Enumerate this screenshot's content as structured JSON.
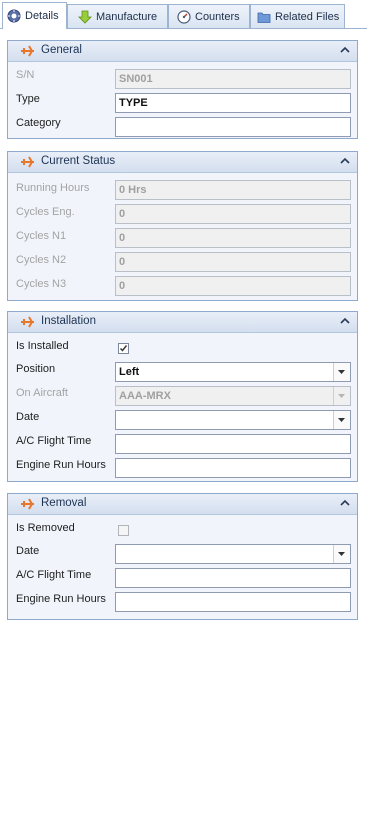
{
  "tabs": [
    {
      "label": "Details",
      "icon": "gear-list-icon",
      "active": true
    },
    {
      "label": "Manufacture",
      "icon": "down-arrow-icon",
      "active": false
    },
    {
      "label": "Counters",
      "icon": "gauge-icon",
      "active": false
    },
    {
      "label": "Related Files",
      "icon": "folder-icon",
      "active": false
    }
  ],
  "general": {
    "title": "General",
    "sn_label": "S/N",
    "sn_value": "SN001",
    "type_label": "Type",
    "type_value": "TYPE",
    "category_label": "Category",
    "category_value": ""
  },
  "current_status": {
    "title": "Current Status",
    "running_hours_label": "Running Hours",
    "running_hours_value": "0 Hrs",
    "cycles_eng_label": "Cycles Eng.",
    "cycles_eng_value": "0",
    "cycles_n1_label": "Cycles N1",
    "cycles_n1_value": "0",
    "cycles_n2_label": "Cycles N2",
    "cycles_n2_value": "0",
    "cycles_n3_label": "Cycles N3",
    "cycles_n3_value": "0"
  },
  "installation": {
    "title": "Installation",
    "is_installed_label": "Is Installed",
    "is_installed_checked": true,
    "position_label": "Position",
    "position_value": "Left",
    "on_aircraft_label": "On Aircraft",
    "on_aircraft_value": "AAA-MRX",
    "date_label": "Date",
    "date_value": "",
    "ac_flight_time_label": "A/C Flight Time",
    "ac_flight_time_value": "",
    "engine_run_hours_label": "Engine Run Hours",
    "engine_run_hours_value": ""
  },
  "removal": {
    "title": "Removal",
    "is_removed_label": "Is Removed",
    "is_removed_checked": false,
    "date_label": "Date",
    "date_value": "",
    "ac_flight_time_label": "A/C Flight Time",
    "ac_flight_time_value": "",
    "engine_run_hours_label": "Engine Run Hours",
    "engine_run_hours_value": ""
  },
  "colors": {
    "accent_orange": "#e8762b",
    "group_border": "#8ea9cc",
    "header_text": "#1e3354"
  }
}
